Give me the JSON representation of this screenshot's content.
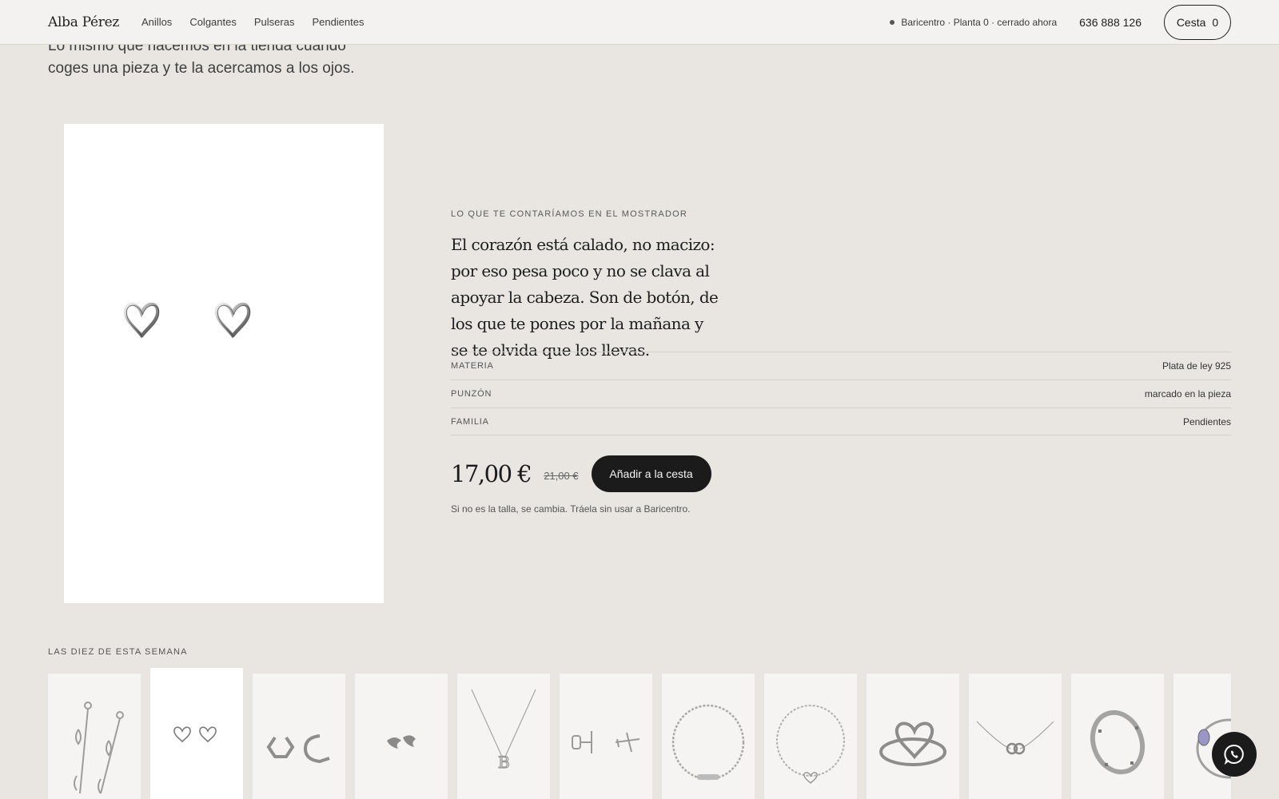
{
  "header": {
    "brand": "Alba Pérez",
    "nav": [
      "Anillos",
      "Colgantes",
      "Pulseras",
      "Pendientes"
    ],
    "store_status": "Baricentro · Planta 0 · cerrado ahora",
    "phone": "636 888 126",
    "cart_label": "Cesta",
    "cart_count": "0"
  },
  "intro": {
    "text": "Lo mismo que hacemos en la tienda cuando coges una pieza y te la acercamos a los ojos."
  },
  "product": {
    "eyebrow": "LO QUE TE CONTARÍAMOS EN EL MOSTRADOR",
    "story": "El corazón está calado, no macizo: por eso pesa poco y no se clava al apoyar la cabeza. Son de botón, de los que te pones por la mañana y se te olvida que los llevas.",
    "specs": [
      {
        "key": "MATERIA",
        "value": "Plata de ley 925"
      },
      {
        "key": "PUNZÓN",
        "value": "marcado en la pieza"
      },
      {
        "key": "FAMILIA",
        "value": "Pendientes"
      }
    ],
    "price": "17,00 €",
    "old_price": "21,00 €",
    "add_to_cart": "Añadir a la cesta",
    "returns_note": "Si no es la talla, se cambia. Tráela sin usar a Baricentro."
  },
  "weekly": {
    "label": "LAS DIEZ DE ESTA SEMANA",
    "items": [
      "drop-earrings-icon",
      "heart-studs-icon",
      "hexagon-hoops-icon",
      "bird-studs-icon",
      "letter-b-necklace-icon",
      "plane-studs-icon",
      "chain-bracelet-icon",
      "heart-bracelet-icon",
      "heart-ring-icon",
      "linked-rings-necklace-icon",
      "engraved-band-ring-icon",
      "gem-ring-icon"
    ],
    "active_index": 1
  },
  "whatsapp": {
    "icon": "whatsapp-icon"
  }
}
